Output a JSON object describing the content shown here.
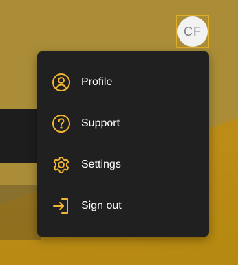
{
  "header": {
    "avatar_initials": "CF"
  },
  "colors": {
    "accent": "#f2b632",
    "menu_background": "#202020",
    "page_background": "#ab8d38"
  },
  "user_menu": {
    "items": [
      {
        "label": "Profile",
        "icon": "user-circle-icon"
      },
      {
        "label": "Support",
        "icon": "question-circle-icon"
      },
      {
        "label": "Settings",
        "icon": "gear-icon"
      },
      {
        "label": "Sign out",
        "icon": "sign-out-icon"
      }
    ]
  }
}
